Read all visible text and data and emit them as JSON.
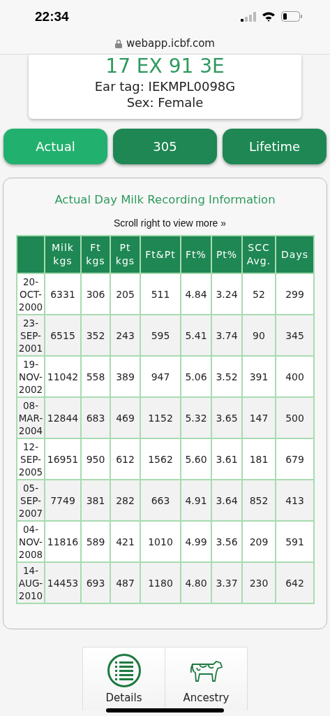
{
  "status_bar": {
    "time": "22:34"
  },
  "address_bar": {
    "url": "webapp.icbf.com"
  },
  "animal_card": {
    "number": "17 EX 91 3E",
    "ear_tag": "Ear tag: IEKMPL0098G",
    "sex": "Sex: Female"
  },
  "tabs": [
    {
      "label": "Actual",
      "selected": true
    },
    {
      "label": "305",
      "selected": false
    },
    {
      "label": "Lifetime",
      "selected": false
    }
  ],
  "panel": {
    "title": "Actual Day Milk Recording Information",
    "hint": "Scroll right to view more »",
    "table": {
      "columns": [
        "",
        "Milk kgs",
        "Ft kgs",
        "Pt kgs",
        "Ft&Pt",
        "Ft%",
        "Pt%",
        "SCC Avg.",
        "Days"
      ],
      "rows": [
        [
          "20-OCT-2000",
          "6331",
          "306",
          "205",
          "511",
          "4.84",
          "3.24",
          "52",
          "299"
        ],
        [
          "23-SEP-2001",
          "6515",
          "352",
          "243",
          "595",
          "5.41",
          "3.74",
          "90",
          "345"
        ],
        [
          "19-NOV-2002",
          "11042",
          "558",
          "389",
          "947",
          "5.06",
          "3.52",
          "391",
          "400"
        ],
        [
          "08-MAR-2004",
          "12844",
          "683",
          "469",
          "1152",
          "5.32",
          "3.65",
          "147",
          "500"
        ],
        [
          "12-SEP-2005",
          "16951",
          "950",
          "612",
          "1562",
          "5.60",
          "3.61",
          "181",
          "679"
        ],
        [
          "05-SEP-2007",
          "7749",
          "381",
          "282",
          "663",
          "4.91",
          "3.64",
          "852",
          "413"
        ],
        [
          "04-NOV-2008",
          "11816",
          "589",
          "421",
          "1010",
          "4.99",
          "3.56",
          "209",
          "591"
        ],
        [
          "14-AUG-2010",
          "14453",
          "693",
          "487",
          "1180",
          "4.80",
          "3.37",
          "230",
          "642"
        ]
      ]
    }
  },
  "bottom_nav": [
    {
      "label": "Details",
      "kind": "list"
    },
    {
      "label": "Ancestry",
      "kind": "cow"
    }
  ]
}
